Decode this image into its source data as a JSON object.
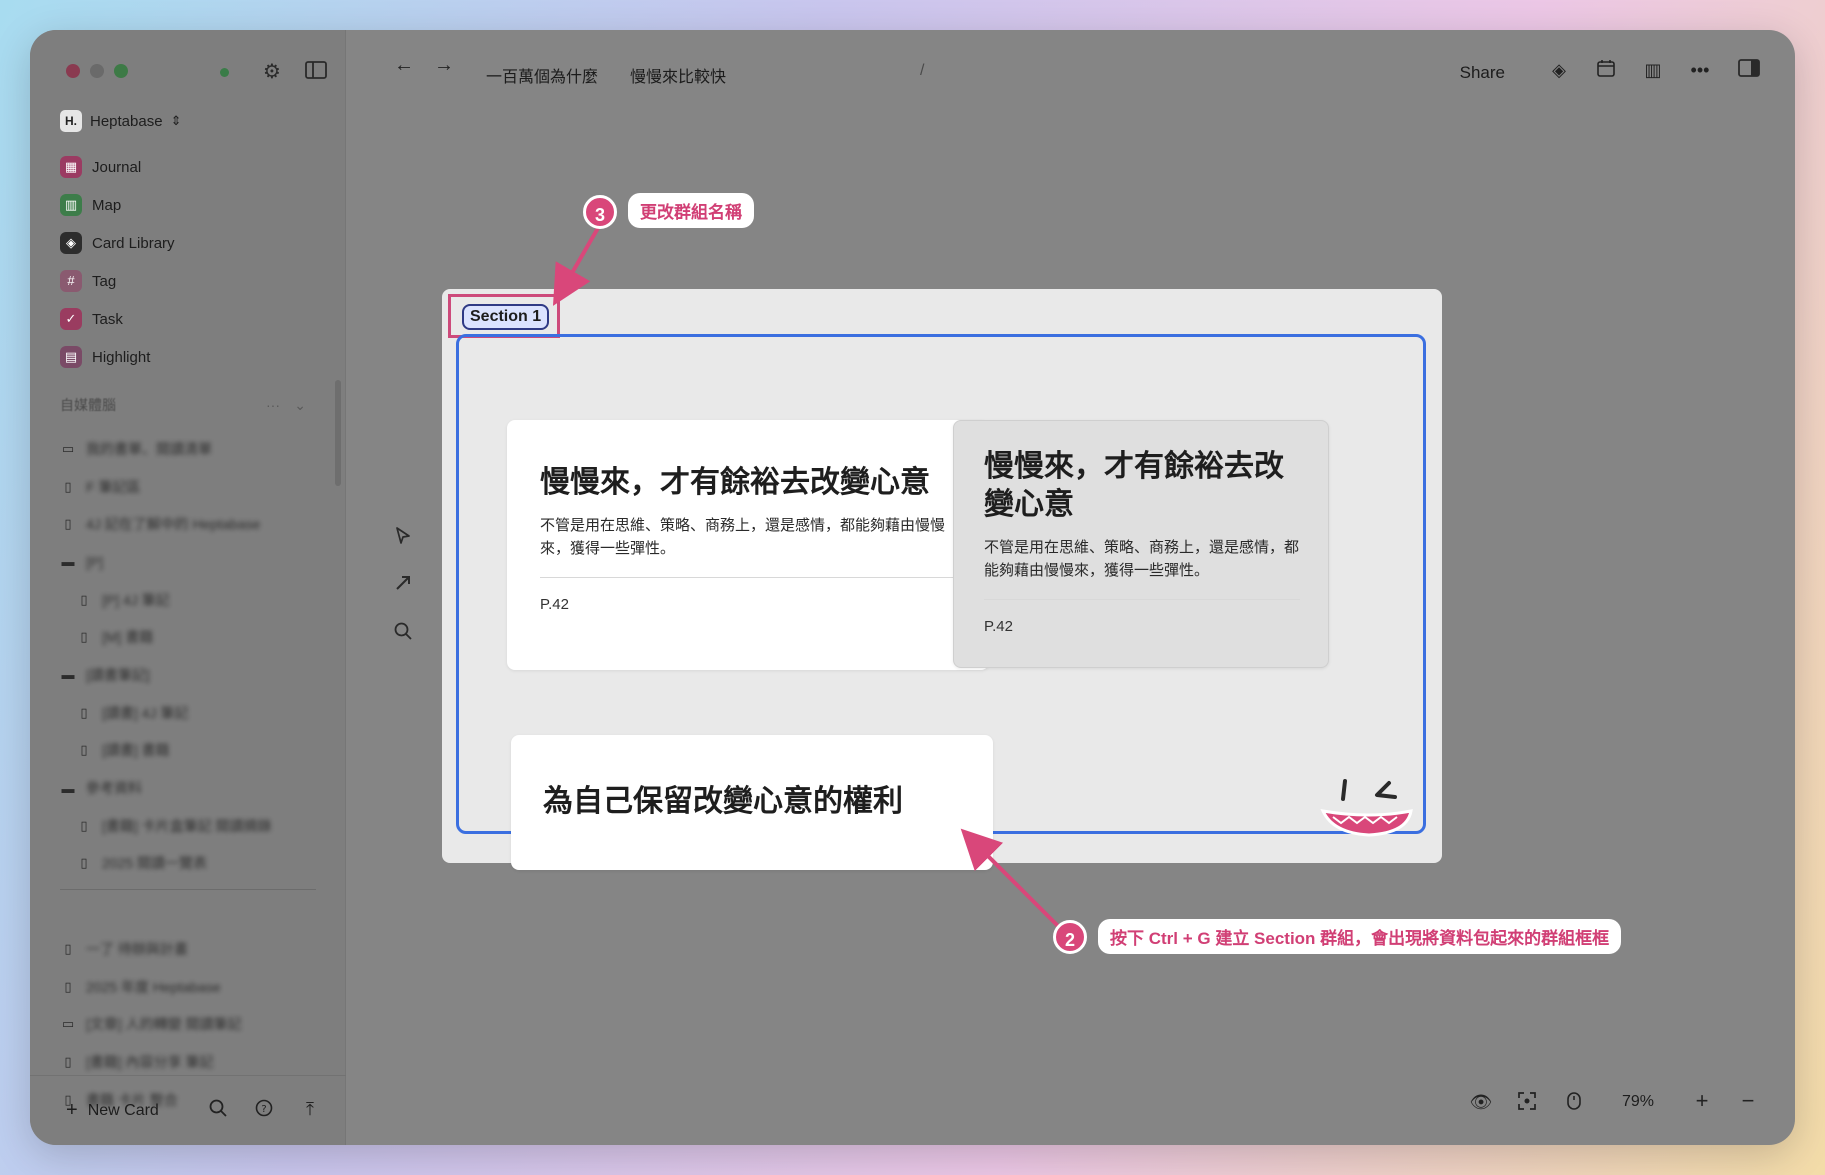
{
  "sidebar": {
    "workspace": "Heptabase",
    "workspace_logo": "H.",
    "nav": [
      {
        "label": "Journal",
        "icon": "calendar-icon",
        "color": "#9b3b62"
      },
      {
        "label": "Map",
        "icon": "map-icon",
        "color": "#3d7d4a"
      },
      {
        "label": "Card Library",
        "icon": "layers-icon",
        "color": "#2d2d2d"
      },
      {
        "label": "Tag",
        "icon": "hash-icon",
        "color": "#8a5a70"
      },
      {
        "label": "Task",
        "icon": "check-circle-icon",
        "color": "#9a3c60"
      },
      {
        "label": "Highlight",
        "icon": "highlight-icon",
        "color": "#7a4a66"
      }
    ],
    "section_label": "自媒體腦",
    "tree": [
      {
        "label": "我的書單、閱讀清單",
        "icon": "whiteboard-icon",
        "indent": false
      },
      {
        "label": "F 筆記區",
        "icon": "card-icon",
        "indent": false
      },
      {
        "label": "4J 記在了解中的 Heptabase",
        "icon": "card-icon",
        "indent": false
      },
      {
        "label": "[P]",
        "icon": "folder-icon",
        "indent": false
      },
      {
        "label": "[P] 4J 筆記",
        "icon": "card-icon",
        "indent": true
      },
      {
        "label": "[M] 書籍",
        "icon": "card-icon",
        "indent": true
      },
      {
        "label": "[讀書筆記]",
        "icon": "folder-icon",
        "indent": false
      },
      {
        "label": "[讀書] 4J 筆記",
        "icon": "card-icon",
        "indent": true
      },
      {
        "label": "[讀書] 書籍",
        "icon": "card-icon",
        "indent": true
      },
      {
        "label": "參考資料",
        "icon": "folder-icon",
        "indent": false
      },
      {
        "label": "[書籍] 卡片盒筆記 閱讀摘錄",
        "icon": "card-icon",
        "indent": true
      },
      {
        "label": "2025 閱讀一覽表",
        "icon": "card-icon",
        "indent": true
      }
    ],
    "tree2": [
      {
        "label": "一了 待辦與計畫",
        "icon": "card-icon"
      },
      {
        "label": "2025 年度 Heptabase",
        "icon": "card-icon"
      },
      {
        "label": "[文章] 人的轉變 閱讀筆記",
        "icon": "whiteboard-icon"
      },
      {
        "label": "[書籍] 內容分享 筆記",
        "icon": "card-icon"
      },
      {
        "label": "書籍 卡片 整合",
        "icon": "card-icon"
      }
    ],
    "new_card": "New Card"
  },
  "header": {
    "breadcrumb": [
      "一百萬個為什麼",
      "慢慢來比較快"
    ],
    "share": "Share"
  },
  "canvas": {
    "section_title": "Section 1",
    "card1": {
      "title": "慢慢來，才有餘裕去改變心意",
      "body": "不管是用在思維、策略、商務上，還是感情，都能夠藉由慢慢來，獲得一些彈性。",
      "page": "P.42"
    },
    "card2": {
      "title": "慢慢來，才有餘裕去改變心意",
      "body": "不管是用在思維、策略、商務上，還是感情，都能夠藉由慢慢來，獲得一些彈性。",
      "page": "P.42"
    },
    "card3": {
      "title": "為自己保留改變心意的權利"
    }
  },
  "annotations": {
    "badge3": "3",
    "callout3": "更改群組名稱",
    "badge2": "2",
    "callout2": "按下 Ctrl + G 建立 Section 群組，會出現將資料包起來的群組框框"
  },
  "zoom": "79%",
  "colors": {
    "accent_pink": "#d9477a",
    "group_border": "#3b6fe0"
  }
}
